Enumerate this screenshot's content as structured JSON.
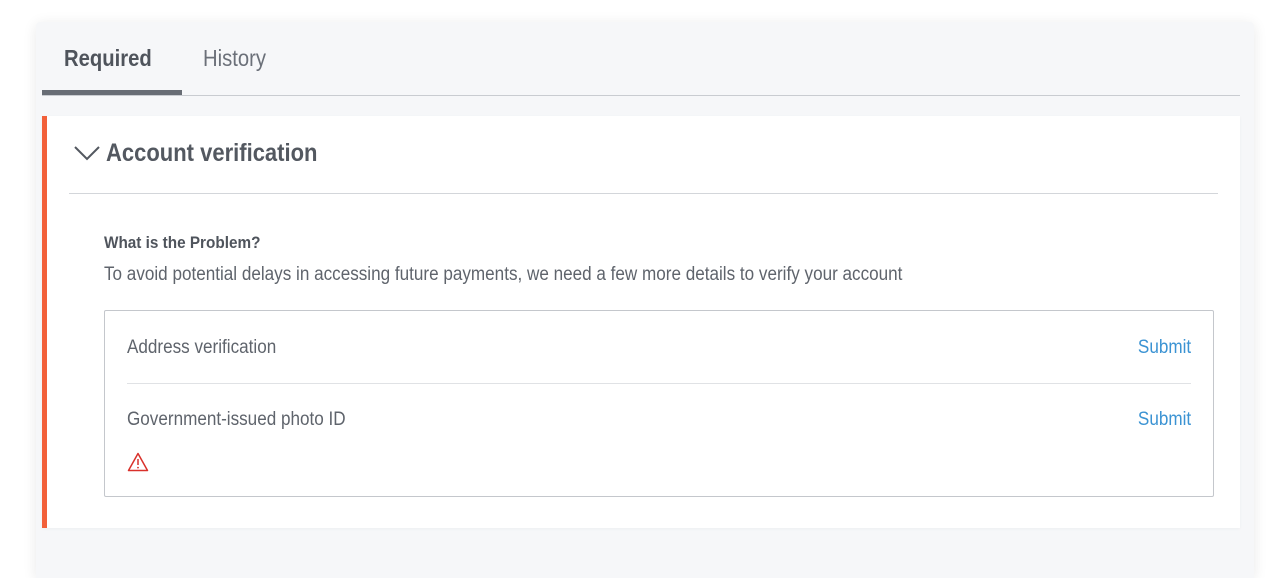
{
  "tabs": [
    {
      "label": "Required",
      "active": true
    },
    {
      "label": "History",
      "active": false
    }
  ],
  "card": {
    "title": "Account verification",
    "accent_color": "#f2603a",
    "expanded": true,
    "problem_title": "What is the Problem?",
    "problem_description": "To avoid potential delays in accessing future payments, we need a few more details to verify your account",
    "requirements": [
      {
        "label": "Address verification",
        "action": "Submit",
        "warning": false
      },
      {
        "label": "Government-issued photo ID",
        "action": "Submit",
        "warning": true
      }
    ]
  },
  "icons": {
    "expand": "chevron-down-icon",
    "warning": "warning-triangle-icon"
  },
  "colors": {
    "link": "#3b93d3",
    "warning": "#d9312b"
  }
}
